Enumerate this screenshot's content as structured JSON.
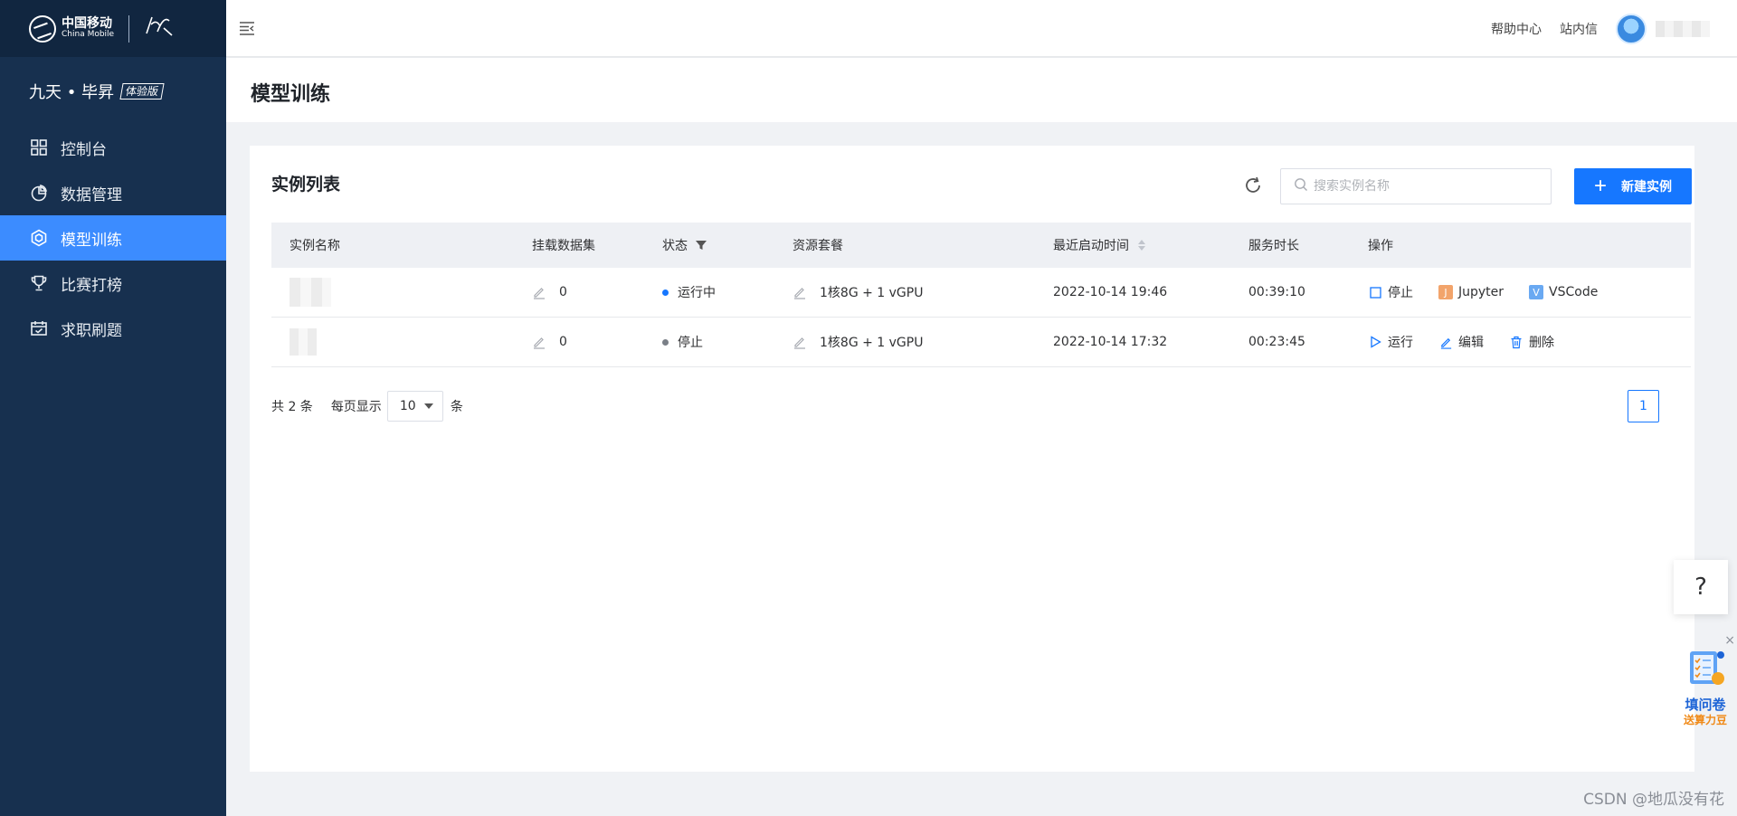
{
  "logo": {
    "cn": "中国移动",
    "en": "China Mobile",
    "sign": "九天"
  },
  "brand": {
    "name": "九天 • 毕昇",
    "tag": "体验版"
  },
  "sidebar": {
    "items": [
      {
        "label": "控制台",
        "icon": "grid-icon"
      },
      {
        "label": "数据管理",
        "icon": "pie-chart-icon"
      },
      {
        "label": "模型训练",
        "icon": "hexagon-icon",
        "active": true
      },
      {
        "label": "比赛打榜",
        "icon": "trophy-icon"
      },
      {
        "label": "求职刷题",
        "icon": "calendar-check-icon"
      }
    ]
  },
  "header": {
    "help_center": "帮助中心",
    "messages": "站内信"
  },
  "page": {
    "title": "模型训练"
  },
  "card": {
    "title": "实例列表",
    "search_placeholder": "搜索实例名称",
    "new_button": "新建实例"
  },
  "table": {
    "columns": [
      "实例名称",
      "挂载数据集",
      "状态",
      "资源套餐",
      "最近启动时间",
      "服务时长",
      "操作"
    ],
    "rows": [
      {
        "datasets": "0",
        "status": "运行中",
        "status_color": "#1677ff",
        "package": "1核8G + 1 vGPU",
        "start_time": "2022-10-14 19:46",
        "duration": "00:39:10",
        "actions": [
          "停止",
          "Jupyter",
          "VSCode"
        ]
      },
      {
        "datasets": "0",
        "status": "停止",
        "status_color": "#7a7f87",
        "package": "1核8G + 1 vGPU",
        "start_time": "2022-10-14 17:32",
        "duration": "00:23:45",
        "actions": [
          "运行",
          "编辑",
          "删除"
        ]
      }
    ]
  },
  "pager": {
    "total": "共 2 条",
    "per_page_label": "每页显示",
    "per_page_value": "10",
    "unit": "条",
    "current_page": "1"
  },
  "floating": {
    "help": "?",
    "survey_title": "填问卷",
    "survey_sub": "送算力豆",
    "close": "×"
  },
  "watermark": "CSDN @地瓜没有花",
  "colors": {
    "sidebar_bg": "#17304f",
    "active": "#3c8cff",
    "primary": "#1677ff"
  }
}
